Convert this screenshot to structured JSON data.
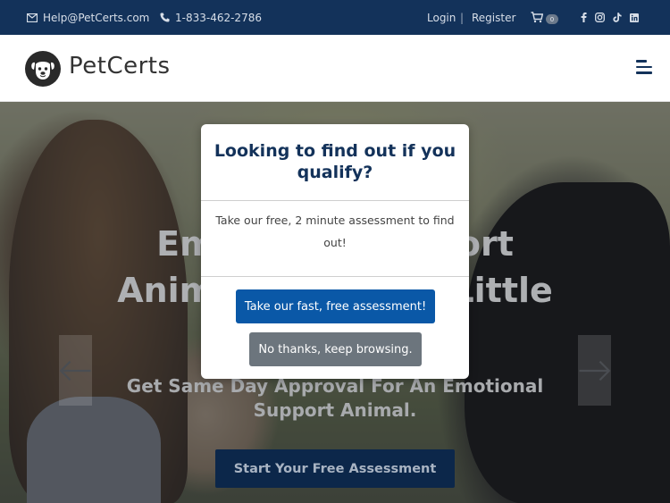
{
  "topbar": {
    "email": "Help@PetCerts.com",
    "phone": "1-833-462-2786",
    "login": "Login",
    "separator": "|",
    "register": "Register",
    "cart_count": "0",
    "icons": [
      "envelope-icon",
      "phone-icon",
      "cart-icon",
      "facebook-icon",
      "instagram-icon",
      "tiktok-icon",
      "linkedin-icon"
    ]
  },
  "header": {
    "logo_text": "PetCerts",
    "menu_icon": "hamburger-menu-icon"
  },
  "hero": {
    "title_line1": "Emotional Support",
    "title_line2": "Animals For Your Little",
    "subtitle_line1": "Get Same Day Approval For An Emotional",
    "subtitle_line2": "Support Animal.",
    "cta": "Start Your Free Assessment",
    "prev_icon": "arrow-left-icon",
    "next_icon": "arrow-right-icon"
  },
  "modal": {
    "title": "Looking to find out if you qualify?",
    "body": "Take our free, 2 minute assessment to find out!",
    "primary_button": "Take our fast, free assessment!",
    "secondary_button": "No thanks, keep browsing."
  },
  "colors": {
    "topbar_bg": "#13325a",
    "primary_button": "#0a58a7",
    "secondary_button": "#6c757d",
    "cta_bg": "#0c274a"
  }
}
